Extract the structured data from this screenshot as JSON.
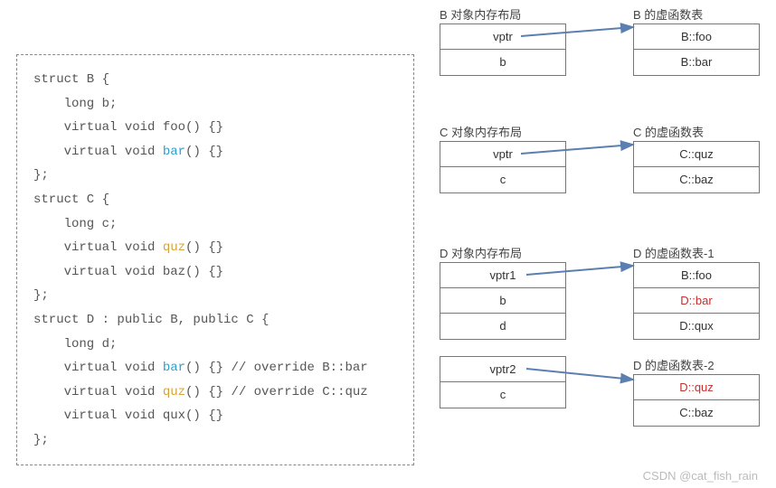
{
  "code": {
    "line1": "struct B {",
    "line2": "    long b;",
    "line3": "    virtual void foo() {}",
    "line4a": "    virtual void ",
    "line4b": "bar",
    "line4c": "() {}",
    "line5": "};",
    "line6": "struct C {",
    "line7": "    long c;",
    "line8a": "    virtual void ",
    "line8b": "quz",
    "line8c": "() {}",
    "line9": "    virtual void baz() {}",
    "line10": "};",
    "line11": "struct D : public B, public C {",
    "line12": "    long d;",
    "line13a": "    virtual void ",
    "line13b": "bar",
    "line13c": "() {} // override B::bar",
    "line14a": "    virtual void ",
    "line14b": "quz",
    "line14c": "() {} // override C::quz",
    "line15": "    virtual void qux() {}",
    "line16": "};"
  },
  "labels": {
    "b_layout": "B 对象内存布局",
    "b_vtable": "B 的虚函数表",
    "c_layout": "C 对象内存布局",
    "c_vtable": "C 的虚函数表",
    "d_layout": "D 对象内存布局",
    "d_vtable1": "D 的虚函数表-1",
    "d_vtable2": "D 的虚函数表-2"
  },
  "b_layout": {
    "r0": "vptr",
    "r1": "b"
  },
  "b_vtable": {
    "r0": "B::foo",
    "r1": "B::bar"
  },
  "c_layout": {
    "r0": "vptr",
    "r1": "c"
  },
  "c_vtable": {
    "r0": "C::quz",
    "r1": "C::baz"
  },
  "d_layout": {
    "r0": "vptr1",
    "r1": "b",
    "r2": "d",
    "r3": "vptr2",
    "r4": "c"
  },
  "d_vtable1": {
    "r0": "B::foo",
    "r1": "D::bar",
    "r2": "D::qux"
  },
  "d_vtable2": {
    "r0": "D::quz",
    "r1": "C::baz"
  },
  "watermark": "CSDN @cat_fish_rain"
}
